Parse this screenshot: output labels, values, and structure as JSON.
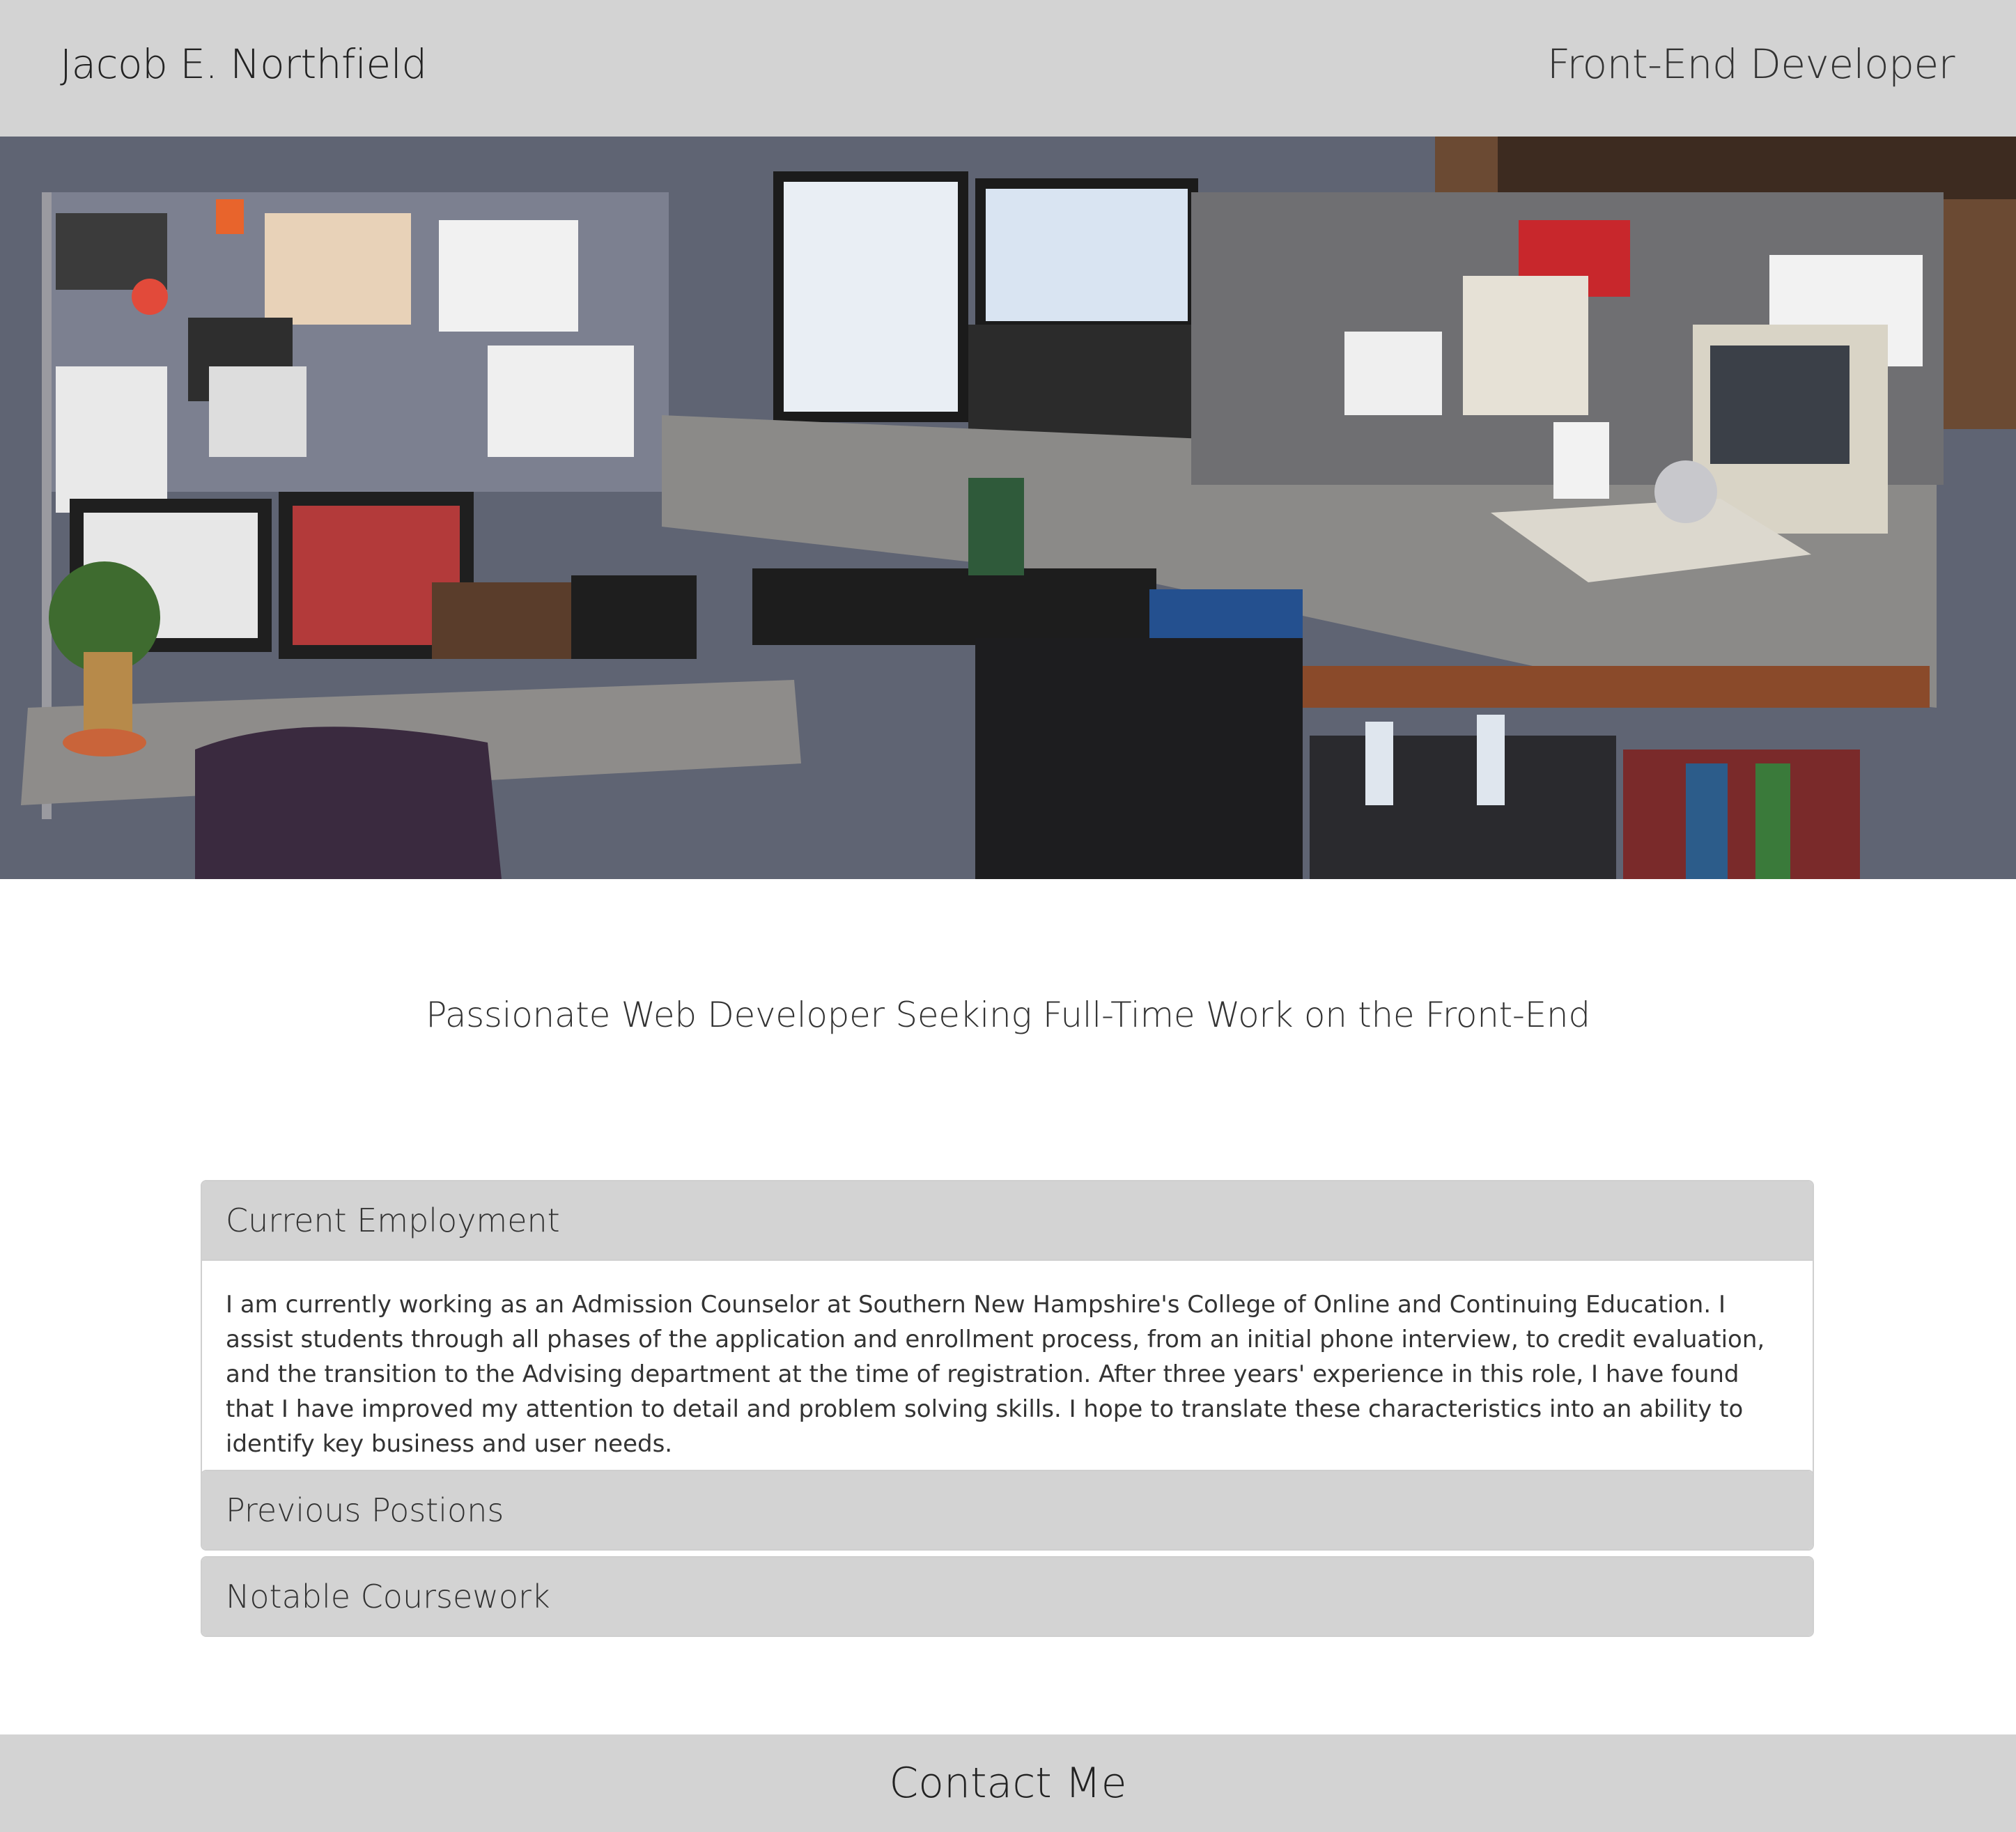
{
  "header": {
    "name": "Jacob E. Northfield",
    "role": "Front-End Developer"
  },
  "hero": {
    "image": "desk-cubicle-photo"
  },
  "tagline": "Passionate Web Developer Seeking Full-Time Work on the Front-End",
  "accordion": [
    {
      "title": "Current Employment",
      "expanded": true,
      "body": "I am currently working as an Admission Counselor at Southern New Hampshire's College of Online and Continuing Education. I assist students through all phases of the application and enrollment process, from an initial phone interview, to credit evaluation, and the transition to the Advising department at the time of registration. After three years' experience in this role, I have found that I have improved my attention to detail and problem solving skills. I hope to translate these characteristics into an ability to identify key business and user needs."
    },
    {
      "title": "Previous Postions",
      "expanded": false
    },
    {
      "title": "Notable Coursework",
      "expanded": false
    }
  ],
  "footer": {
    "label": "Contact Me"
  },
  "colors": {
    "bar_background": "#d3d3d3",
    "text": "#333333"
  }
}
